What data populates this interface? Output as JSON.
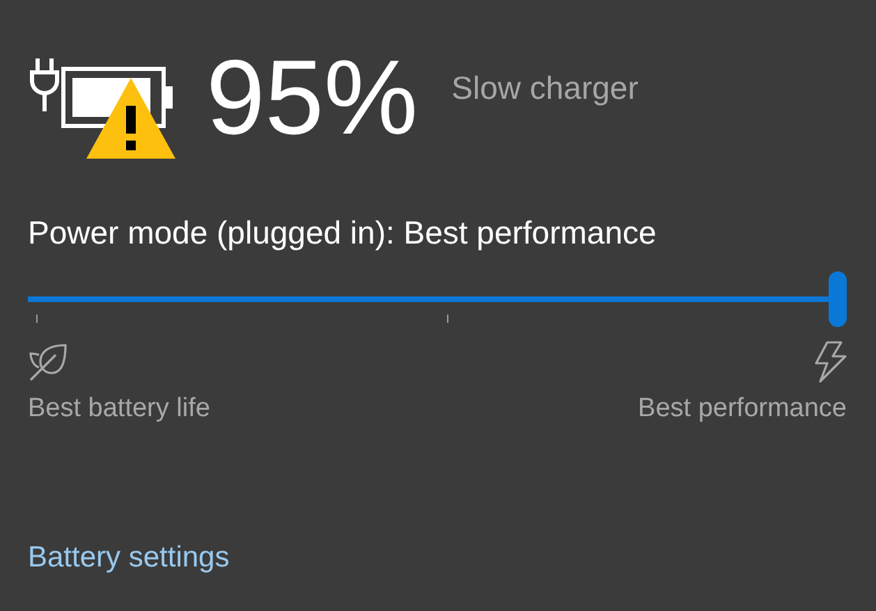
{
  "battery": {
    "percent": "95%",
    "charger_status": "Slow charger",
    "plugged_in": true,
    "warning": true
  },
  "power_mode": {
    "title": "Power mode (plugged in): Best performance",
    "level": 1,
    "min_label": "Best battery life",
    "max_label": "Best performance"
  },
  "link": "Battery settings"
}
